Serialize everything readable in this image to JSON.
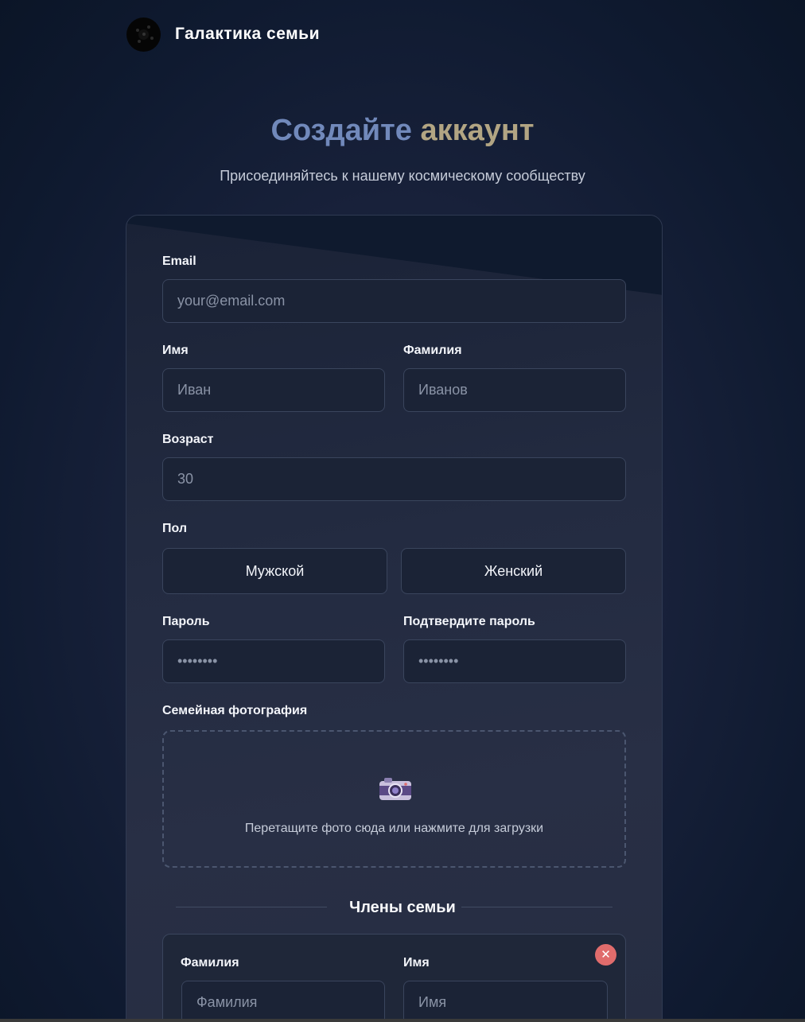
{
  "header": {
    "brand": "Галактика семьи",
    "logo_icon": "galaxy-logo-icon"
  },
  "hero": {
    "title_part1": "Создайте",
    "title_part2": "аккаунт",
    "subtitle": "Присоединяйтесь к нашему космическому сообществу"
  },
  "form": {
    "email": {
      "label": "Email",
      "placeholder": "your@email.com"
    },
    "first_name": {
      "label": "Имя",
      "placeholder": "Иван"
    },
    "last_name": {
      "label": "Фамилия",
      "placeholder": "Иванов"
    },
    "age": {
      "label": "Возраст",
      "placeholder": "30"
    },
    "gender": {
      "label": "Пол",
      "options": [
        "Мужской",
        "Женский"
      ]
    },
    "password": {
      "label": "Пароль",
      "placeholder": "••••••••"
    },
    "confirm_password": {
      "label": "Подтвердите пароль",
      "placeholder": "••••••••"
    },
    "photo": {
      "label": "Семейная фотография",
      "hint": "Перетащите фото сюда или нажмите для загрузки",
      "icon": "camera-icon"
    }
  },
  "family": {
    "title": "Члены семьи",
    "member": {
      "last_name_label": "Фамилия",
      "last_name_placeholder": "Фамилия",
      "first_name_label": "Имя",
      "first_name_placeholder": "Имя",
      "remove_icon": "close-icon"
    }
  },
  "colors": {
    "title_blue": "#7189bb",
    "title_gold": "#b2a583",
    "remove_red": "#e06c6c"
  }
}
